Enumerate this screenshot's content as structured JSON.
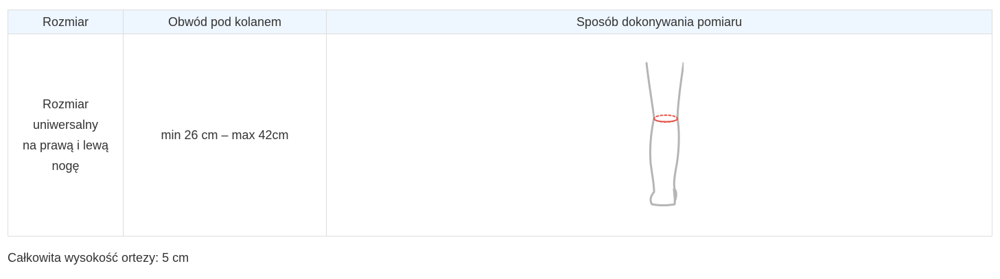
{
  "table": {
    "headers": [
      "Rozmiar",
      "Obwód pod kolanem",
      "Sposób dokonywania pomiaru"
    ],
    "rows": [
      {
        "size_lines": [
          "Rozmiar",
          "uniwersalny",
          "na prawą i lewą",
          "nogę"
        ],
        "circumference": "min 26 cm – max 42cm",
        "illustration": "leg-measurement-icon"
      }
    ]
  },
  "footer": {
    "note": "Całkowita wysokość ortezy: 5 cm"
  },
  "colors": {
    "header_background": "#eef6ff",
    "border": "#dddddd",
    "text": "#333333",
    "leg_outline": "#b5b5b5",
    "measure_line": "#e2574c"
  }
}
